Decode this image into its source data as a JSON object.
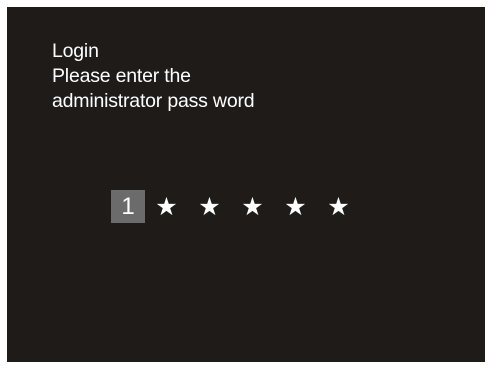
{
  "screen": {
    "background": "#1f1b18",
    "text_color": "#ffffff",
    "active_digit_bg": "#6b6b6b"
  },
  "prompt": {
    "title": "Login",
    "line2": "Please enter the",
    "line3": "administrator pass word"
  },
  "pin": {
    "active_digit": "1",
    "masked": [
      "★",
      "★",
      "★",
      "★",
      "★"
    ]
  }
}
